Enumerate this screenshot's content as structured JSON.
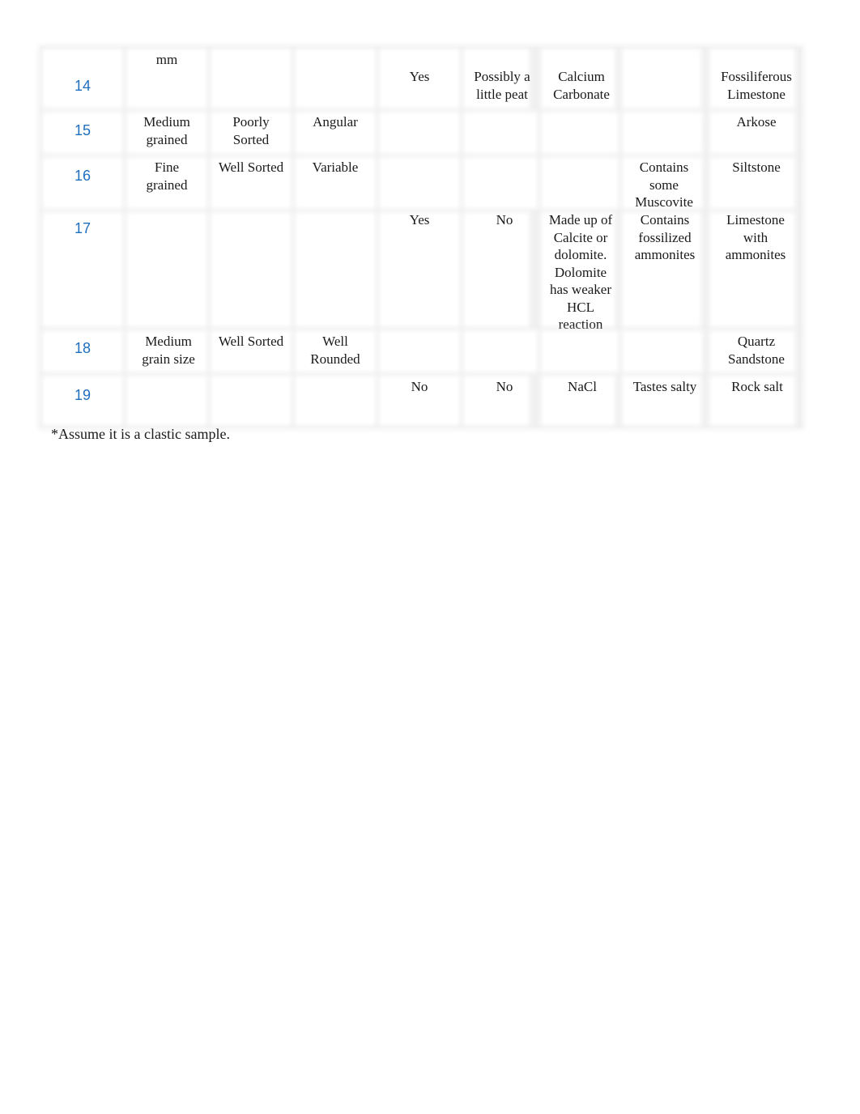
{
  "table": {
    "rows": [
      {
        "num": "14",
        "grain_size": "mm",
        "sorting": "",
        "rounding": "",
        "fizzes": "Yes",
        "organic": "Possibly a little peat",
        "composition": "Calcium Carbonate",
        "other": "",
        "rock_name": "Fossiliferous Limestone"
      },
      {
        "num": "15",
        "grain_size": "Medium grained",
        "sorting": "Poorly Sorted",
        "rounding": "Angular",
        "fizzes": "",
        "organic": "",
        "composition": "",
        "other": "",
        "rock_name": "Arkose"
      },
      {
        "num": "16",
        "grain_size": "Fine grained",
        "sorting": "Well Sorted",
        "rounding": "Variable",
        "fizzes": "",
        "organic": "",
        "composition": "",
        "other": "Contains some Muscovite",
        "rock_name": "Siltstone"
      },
      {
        "num": "17",
        "grain_size": "",
        "sorting": "",
        "rounding": "",
        "fizzes": "Yes",
        "organic": "No",
        "composition": "Made up of Calcite or dolomite. Dolomite has weaker HCL reaction",
        "other": "Contains fossilized ammonites",
        "rock_name": "Limestone with ammonites"
      },
      {
        "num": "18",
        "grain_size": "Medium grain size",
        "sorting": "Well Sorted",
        "rounding": "Well Rounded",
        "fizzes": "",
        "organic": "",
        "composition": "",
        "other": "",
        "rock_name": "Quartz Sandstone"
      },
      {
        "num": "19",
        "grain_size": "",
        "sorting": "",
        "rounding": "",
        "fizzes": "No",
        "organic": "No",
        "composition": "NaCl",
        "other": "Tastes salty",
        "rock_name": "Rock salt"
      }
    ]
  },
  "footnote": "*Assume it is a clastic sample."
}
